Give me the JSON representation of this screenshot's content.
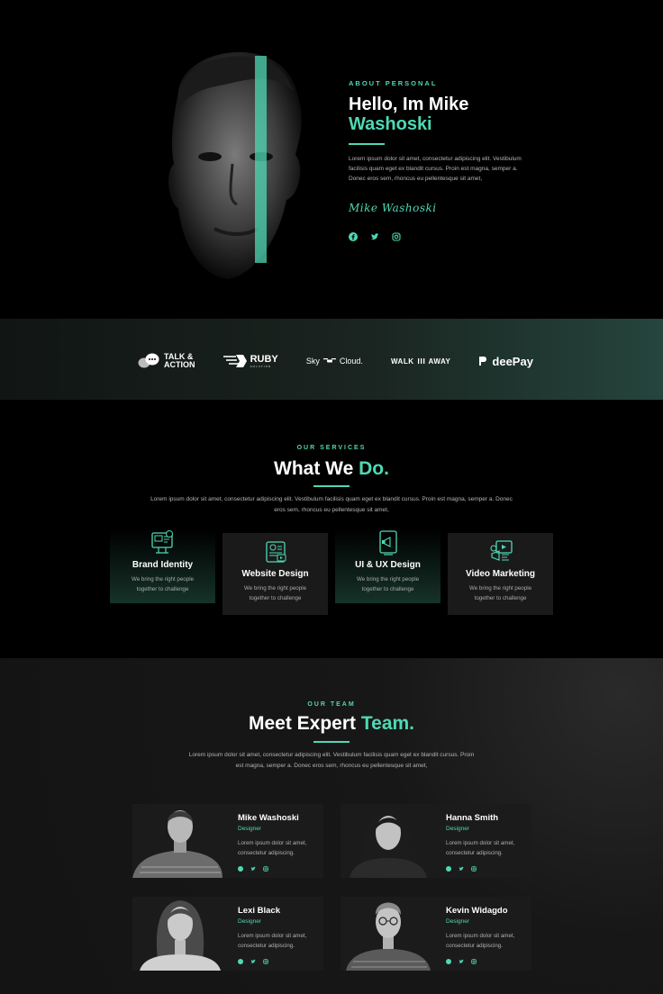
{
  "hero": {
    "eyebrow": "ABOUT PERSONAL",
    "title_line1": "Hello, Im Mike",
    "title_line2": "Washoski",
    "paragraph": "Lorem ipsum dolor sit amet, consectetur adipiscing elit. Vestibulum facilisis quam eget ex blandit cursus. Proin est magna, semper a. Donec eros sem, rhoncus eu pellentesque sit amet,",
    "signature": "Mike Washoski",
    "socials": [
      "facebook-icon",
      "twitter-icon",
      "instagram-icon"
    ]
  },
  "clients": {
    "logos": [
      {
        "line1": "TALK &",
        "line2": "ACTION",
        "icon": "chat-bubbles-icon"
      },
      {
        "name": "RUBY",
        "tagline": "SOLUTION",
        "icon": "ruby-arrow-icon"
      },
      {
        "left": "Sky",
        "right": "Cloud.",
        "icon": "drone-icon"
      },
      {
        "left": "WALK",
        "right": "AWAY",
        "icon": "bars-icon"
      },
      {
        "name": "deePay",
        "icon": "deepay-mark-icon"
      }
    ]
  },
  "services": {
    "eyebrow": "OUR SERVICES",
    "title_white": "What We",
    "title_accent": "Do.",
    "paragraph": "Lorem ipsum dolor sit amet, consectetur adipiscing elit. Vestibulum facilisis quam eget ex blandit cursus. Proin est magna, semper a. Donec eros sem, rhoncus eu pellentesque sit amet,",
    "cards": [
      {
        "title": "Brand Identity",
        "text": "We bring the right people together to challenge",
        "icon": "brand-identity-icon"
      },
      {
        "title": "Website Design",
        "text": "We bring the right people together to challenge",
        "icon": "website-design-icon"
      },
      {
        "title": "UI & UX Design",
        "text": "We bring the right people together to challenge",
        "icon": "ui-ux-design-icon"
      },
      {
        "title": "Video Marketing",
        "text": "We bring the right people together to challenge",
        "icon": "video-marketing-icon"
      }
    ]
  },
  "team": {
    "eyebrow": "OUR TEAM",
    "title_white": "Meet Expert",
    "title_accent": "Team.",
    "paragraph": "Lorem ipsum dolor sit amet, consectetur adipiscing elit. Vestibulum facilisis quam eget ex blandit cursus. Proin est magna, semper a. Donec eros sem, rhoncus eu pellentesque sit amet,",
    "members": [
      {
        "name": "Mike Washoski",
        "role": "Designer",
        "text": "Lorem ipsum dolor sit amet, consectetur adipiscing."
      },
      {
        "name": "Hanna Smith",
        "role": "Designer",
        "text": "Lorem ipsum dolor sit amet, consectetur adipiscing."
      },
      {
        "name": "Lexi Black",
        "role": "Designer",
        "text": "Lorem ipsum dolor sit amet, consectetur adipiscing."
      },
      {
        "name": "Kevin Widagdo",
        "role": "Designer",
        "text": "Lorem ipsum dolor sit amet, consectetur adipiscing."
      }
    ]
  },
  "colors": {
    "accent": "#4fd8b4",
    "background": "#000000",
    "card": "#1a1a1a"
  }
}
